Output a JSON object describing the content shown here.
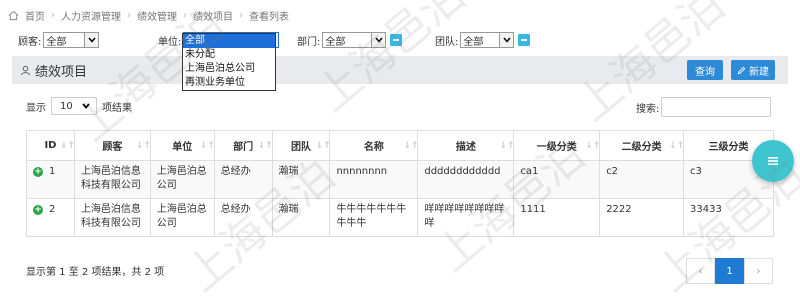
{
  "breadcrumb": [
    "首页",
    "人力资源管理",
    "绩效管理",
    "绩效项目",
    "查看列表"
  ],
  "filters": {
    "customer": {
      "label": "顾客:",
      "value": "全部"
    },
    "unit": {
      "label": "单位:",
      "value": "全部"
    },
    "department": {
      "label": "部门:",
      "value": "全部"
    },
    "team": {
      "label": "团队:",
      "value": "全部"
    }
  },
  "unit_dropdown": [
    "全部",
    "未分配",
    "上海邑泊总公司",
    "再测业务单位"
  ],
  "panel": {
    "title": "绩效项目",
    "query_label": "查询",
    "new_label": "新建"
  },
  "length_menu": {
    "prefix": "显示",
    "value": "10",
    "suffix": "项结果"
  },
  "search_label": "搜索:",
  "table": {
    "columns": [
      "ID",
      "顾客",
      "单位",
      "部门",
      "团队",
      "名称",
      "描述",
      "一级分类",
      "二级分类",
      "三级分类"
    ],
    "rows": [
      {
        "id": "1",
        "customer": "上海邑泊信息科技有限公司",
        "unit": "上海邑泊总公司",
        "department": "总经办",
        "team": "瀚瑞",
        "name": "nnnnnnnn",
        "desc": "dddddddddddd",
        "cat1": "ca1",
        "cat2": "c2",
        "cat3": "c3"
      },
      {
        "id": "2",
        "customer": "上海邑泊信息科技有限公司",
        "unit": "上海邑泊总公司",
        "department": "总经办",
        "team": "瀚瑞",
        "name": "牛牛牛牛牛牛牛牛牛牛",
        "desc": "咩咩咩咩咩咩咩咩咩",
        "cat1": "1111",
        "cat2": "2222",
        "cat3": "33433"
      }
    ]
  },
  "info_text": "显示第 1 至 2 项结果，共 2 项",
  "pager": {
    "prev": "‹",
    "page": "1",
    "next": "›"
  },
  "watermark": "上海邑泊",
  "colors": {
    "primary": "#2d8ad6",
    "accent": "#35b7e8",
    "fab": "#3fc5cf",
    "plus": "#2aa44a"
  }
}
